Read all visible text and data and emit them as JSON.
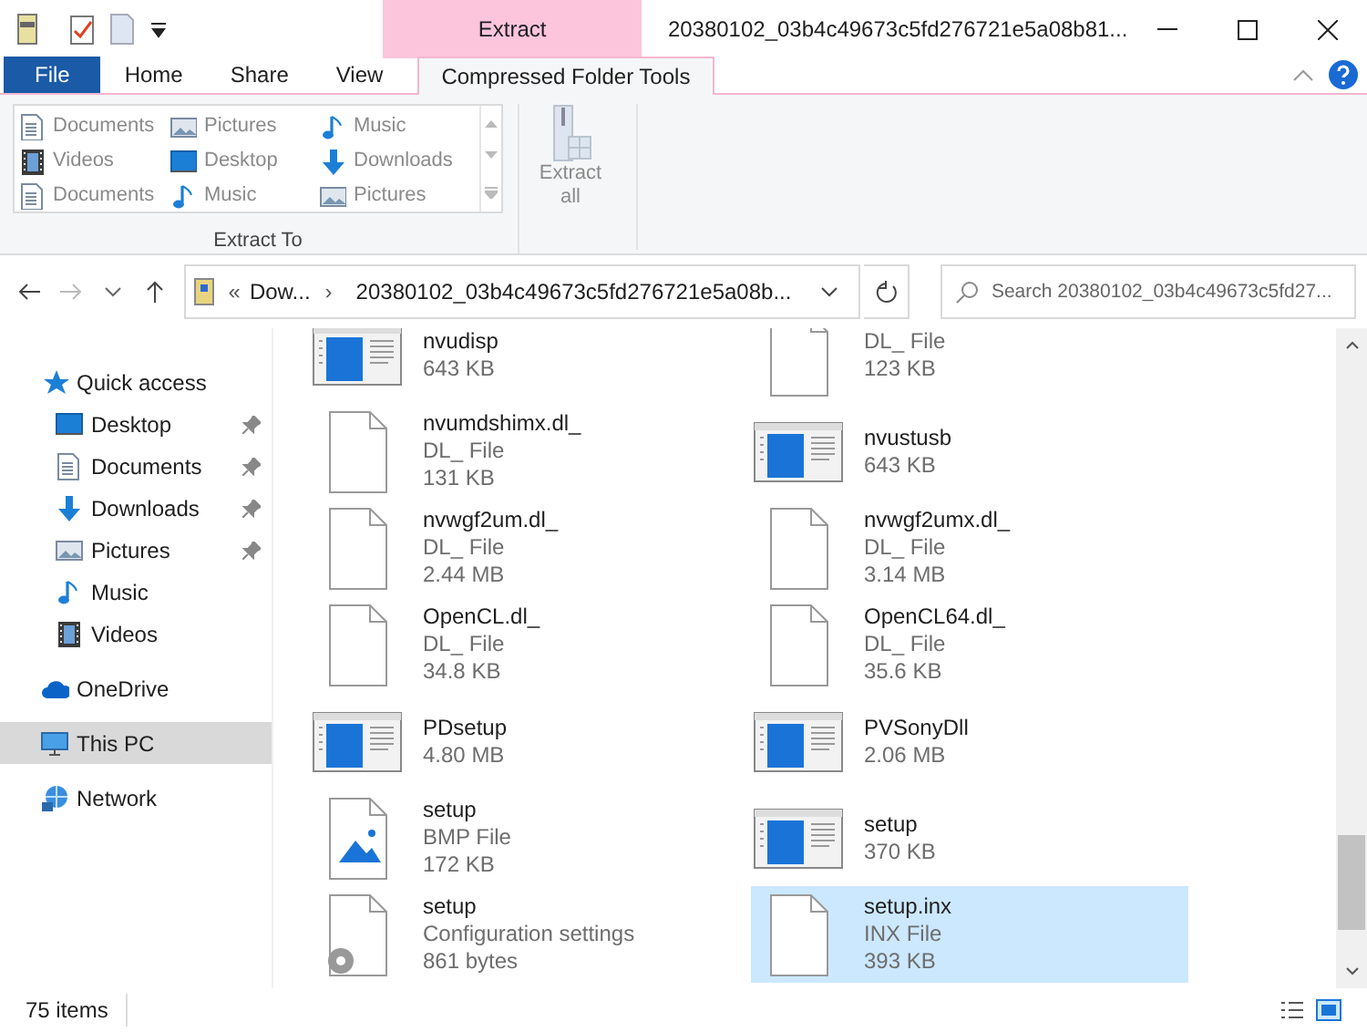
{
  "window": {
    "title": "20380102_03b4c49673c5fd276721e5a08b81...",
    "context_header": "Extract"
  },
  "tabs": [
    {
      "label": "File",
      "kind": "file",
      "selected": false
    },
    {
      "label": "Home",
      "kind": "tab",
      "selected": false
    },
    {
      "label": "Share",
      "kind": "tab",
      "selected": false
    },
    {
      "label": "View",
      "kind": "tab",
      "selected": false
    },
    {
      "label": "Compressed Folder Tools",
      "kind": "tab",
      "selected": true
    }
  ],
  "ribbon": {
    "gallery": [
      {
        "label": "Documents",
        "kind": "doc"
      },
      {
        "label": "Pictures",
        "kind": "pic"
      },
      {
        "label": "Music",
        "kind": "music"
      },
      {
        "label": "Videos",
        "kind": "video"
      },
      {
        "label": "Desktop",
        "kind": "desktop"
      },
      {
        "label": "Downloads",
        "kind": "down"
      },
      {
        "label": "Documents",
        "kind": "doc"
      },
      {
        "label": "Music",
        "kind": "music"
      },
      {
        "label": "Pictures",
        "kind": "pic"
      }
    ],
    "group_label": "Extract To",
    "extract_all": "Extract all"
  },
  "address": {
    "overflow": "«",
    "segments": [
      "Dow...",
      "20380102_03b4c49673c5fd276721e5a08b..."
    ],
    "separator": "›",
    "search_placeholder": "Search 20380102_03b4c49673c5fd27..."
  },
  "sidebar": {
    "items": [
      {
        "label": "Quick access",
        "kind": "star",
        "pinned": false,
        "selected": false,
        "children": [
          {
            "label": "Desktop",
            "kind": "desktop",
            "pinned": true,
            "selected": false
          },
          {
            "label": "Documents",
            "kind": "doc",
            "pinned": true,
            "selected": false
          },
          {
            "label": "Downloads",
            "kind": "down",
            "pinned": true,
            "selected": false
          },
          {
            "label": "Pictures",
            "kind": "pic",
            "pinned": true,
            "selected": false
          },
          {
            "label": "Music",
            "kind": "music",
            "pinned": false,
            "selected": false
          },
          {
            "label": "Videos",
            "kind": "video",
            "pinned": false,
            "selected": false
          }
        ]
      },
      {
        "label": "OneDrive",
        "kind": "cloud",
        "pinned": false,
        "selected": false
      },
      {
        "label": "This PC",
        "kind": "pc",
        "pinned": false,
        "selected": true
      },
      {
        "label": "Network",
        "kind": "net",
        "pinned": false,
        "selected": false
      }
    ]
  },
  "files": [
    {
      "kind": "exe",
      "lines": [
        "nvudisp",
        "643 KB"
      ],
      "selected": false
    },
    {
      "kind": "file",
      "lines": [
        "DL_ File",
        "123 KB"
      ],
      "selected": false
    },
    {
      "kind": "file",
      "lines": [
        "nvumdshimx.dl_",
        "DL_ File",
        "131 KB"
      ],
      "selected": false
    },
    {
      "kind": "exe",
      "lines": [
        "nvustusb",
        "643 KB"
      ],
      "selected": false
    },
    {
      "kind": "file",
      "lines": [
        "nvwgf2um.dl_",
        "DL_ File",
        "2.44 MB"
      ],
      "selected": false
    },
    {
      "kind": "file",
      "lines": [
        "nvwgf2umx.dl_",
        "DL_ File",
        "3.14 MB"
      ],
      "selected": false
    },
    {
      "kind": "file",
      "lines": [
        "OpenCL.dl_",
        "DL_ File",
        "34.8 KB"
      ],
      "selected": false
    },
    {
      "kind": "file",
      "lines": [
        "OpenCL64.dl_",
        "DL_ File",
        "35.6 KB"
      ],
      "selected": false
    },
    {
      "kind": "exe",
      "lines": [
        "PDsetup",
        "4.80 MB"
      ],
      "selected": false
    },
    {
      "kind": "exe",
      "lines": [
        "PVSonyDll",
        "2.06 MB"
      ],
      "selected": false
    },
    {
      "kind": "bmp",
      "lines": [
        "setup",
        "BMP File",
        "172 KB"
      ],
      "selected": false
    },
    {
      "kind": "exe",
      "lines": [
        "setup",
        "370 KB"
      ],
      "selected": false
    },
    {
      "kind": "config",
      "lines": [
        "setup",
        "Configuration settings",
        "861 bytes"
      ],
      "selected": false
    },
    {
      "kind": "file",
      "lines": [
        "setup.inx",
        "INX File",
        "393 KB"
      ],
      "selected": true
    }
  ],
  "status_bar": {
    "count": "75 items"
  }
}
